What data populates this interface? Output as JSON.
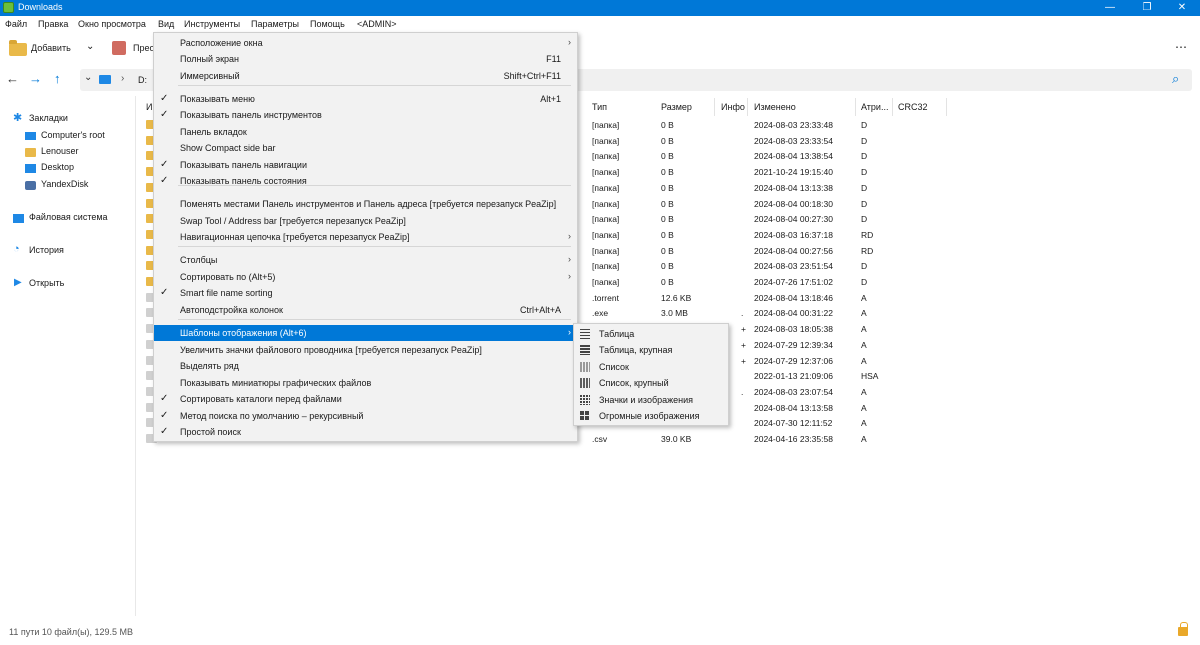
{
  "window": {
    "title": "Downloads",
    "min": "—",
    "max": "❐",
    "close": "✕"
  },
  "menubar": [
    "Файл",
    "Правка",
    "Окно просмотра",
    "Вид",
    "Инструменты",
    "Параметры",
    "Помощь",
    "<ADMIN>"
  ],
  "toolbar": {
    "add_label": "Добавить",
    "convert_label": "Прео",
    "more": "⋯"
  },
  "address": {
    "path": "D:"
  },
  "sidebar": {
    "bookmarks": "Закладки",
    "items": [
      "Computer's root",
      "Lenouser",
      "Desktop",
      "YandexDisk"
    ],
    "filesystem": "Файловая система",
    "history": "История",
    "open": "Открыть"
  },
  "columns": {
    "name": "И",
    "type": "Тип",
    "size": "Размер",
    "info": "Инфо",
    "modified": "Изменено",
    "attr": "Атри...",
    "crc": "CRC32"
  },
  "rows": [
    {
      "type": "[папка]",
      "size": "0 B",
      "info": "",
      "modified": "2024-08-03 23:33:48",
      "attr": "D"
    },
    {
      "type": "[папка]",
      "size": "0 B",
      "info": "",
      "modified": "2024-08-03 23:33:54",
      "attr": "D"
    },
    {
      "type": "[папка]",
      "size": "0 B",
      "info": "",
      "modified": "2024-08-04 13:38:54",
      "attr": "D"
    },
    {
      "type": "[папка]",
      "size": "0 B",
      "info": "",
      "modified": "2021-10-24 19:15:40",
      "attr": "D"
    },
    {
      "type": "[папка]",
      "size": "0 B",
      "info": "",
      "modified": "2024-08-04 13:13:38",
      "attr": "D"
    },
    {
      "type": "[папка]",
      "size": "0 B",
      "info": "",
      "modified": "2024-08-04 00:18:30",
      "attr": "D"
    },
    {
      "type": "[папка]",
      "size": "0 B",
      "info": "",
      "modified": "2024-08-04 00:27:30",
      "attr": "D"
    },
    {
      "type": "[папка]",
      "size": "0 B",
      "info": "",
      "modified": "2024-08-03 16:37:18",
      "attr": "RD"
    },
    {
      "type": "[папка]",
      "size": "0 B",
      "info": "",
      "modified": "2024-08-04 00:27:56",
      "attr": "RD"
    },
    {
      "type": "[папка]",
      "size": "0 B",
      "info": "",
      "modified": "2024-08-03 23:51:54",
      "attr": "D"
    },
    {
      "type": "[папка]",
      "size": "0 B",
      "info": "",
      "modified": "2024-07-26 17:51:02",
      "attr": "D"
    },
    {
      "type": ".torrent",
      "size": "12.6 KB",
      "info": "",
      "modified": "2024-08-04 13:18:46",
      "attr": "A"
    },
    {
      "type": ".exe",
      "size": "3.0 MB",
      "info": ".",
      "modified": "2024-08-04 00:31:22",
      "attr": "A"
    },
    {
      "type": "",
      "size": "",
      "info": "+",
      "modified": "2024-08-03 18:05:38",
      "attr": "A"
    },
    {
      "type": "",
      "size": "",
      "info": "+",
      "modified": "2024-07-29 12:39:34",
      "attr": "A"
    },
    {
      "type": "",
      "size": "",
      "info": "+",
      "modified": "2024-07-29 12:37:06",
      "attr": "A"
    },
    {
      "type": "",
      "size": "",
      "info": "",
      "modified": "2022-01-13 21:09:06",
      "attr": "HSA"
    },
    {
      "type": "",
      "size": "",
      "info": ".",
      "modified": "2024-08-03 23:07:54",
      "attr": "A"
    },
    {
      "type": "",
      "size": "",
      "info": "",
      "modified": "2024-08-04 13:13:58",
      "attr": "A"
    },
    {
      "type": "",
      "size": "",
      "info": "",
      "modified": "2024-07-30 12:11:52",
      "attr": "A"
    },
    {
      "type": ".csv",
      "size": "39.0 KB",
      "info": "",
      "modified": "2024-04-16 23:35:58",
      "attr": "A"
    }
  ],
  "status": {
    "text": "11 пути 10 файл(ы), 129.5 MB"
  },
  "view_menu": {
    "items": [
      {
        "label": "Расположение окна",
        "check": "",
        "shortcut": "",
        "arrow": "›"
      },
      {
        "label": "Полный экран",
        "check": "",
        "shortcut": "F11",
        "arrow": ""
      },
      {
        "label": "Иммерсивный",
        "check": "",
        "shortcut": "Shift+Ctrl+F11",
        "arrow": ""
      },
      {
        "label": "Показывать меню",
        "check": "✓",
        "shortcut": "Alt+1",
        "arrow": ""
      },
      {
        "label": "Показывать панель инструментов",
        "check": "✓",
        "shortcut": "",
        "arrow": ""
      },
      {
        "label": "Панель вкладок",
        "check": "",
        "shortcut": "",
        "arrow": ""
      },
      {
        "label": "Show Compact side bar",
        "check": "",
        "shortcut": "",
        "arrow": ""
      },
      {
        "label": "Показывать панель навигации",
        "check": "✓",
        "shortcut": "",
        "arrow": ""
      },
      {
        "label": "Показывать панель состояния",
        "check": "✓",
        "shortcut": "",
        "arrow": ""
      },
      {
        "label": "Поменять местами Панель инструментов и Панель адреса [требуется перезапуск PeaZip]",
        "check": "",
        "shortcut": "",
        "arrow": ""
      },
      {
        "label": "Swap Tool / Address bar [требуется перезапуск PeaZip]",
        "check": "",
        "shortcut": "",
        "arrow": ""
      },
      {
        "label": "Навигационная цепочка [требуется перезапуск PeaZip]",
        "check": "",
        "shortcut": "",
        "arrow": "›"
      },
      {
        "label": "Столбцы",
        "check": "",
        "shortcut": "",
        "arrow": "›"
      },
      {
        "label": "Сортировать по (Alt+5)",
        "check": "",
        "shortcut": "",
        "arrow": "›"
      },
      {
        "label": "Smart file name sorting",
        "check": "✓",
        "shortcut": "",
        "arrow": ""
      },
      {
        "label": "Автоподстройка колонок",
        "check": "",
        "shortcut": "Ctrl+Alt+A",
        "arrow": ""
      },
      {
        "label": "Шаблоны отображения (Alt+6)",
        "check": "",
        "shortcut": "",
        "arrow": "›"
      },
      {
        "label": "Увеличить значки файлового проводника [требуется перезапуск PeaZip]",
        "check": "",
        "shortcut": "",
        "arrow": ""
      },
      {
        "label": "Выделять ряд",
        "check": "",
        "shortcut": "",
        "arrow": ""
      },
      {
        "label": "Показывать миниатюры графических файлов",
        "check": "",
        "shortcut": "",
        "arrow": ""
      },
      {
        "label": "Сортировать каталоги перед файлами",
        "check": "✓",
        "shortcut": "",
        "arrow": ""
      },
      {
        "label": "Метод поиска по умолчанию – рекурсивный",
        "check": "✓",
        "shortcut": "",
        "arrow": ""
      },
      {
        "label": "Простой поиск",
        "check": "✓",
        "shortcut": "",
        "arrow": ""
      }
    ]
  },
  "layout_submenu": {
    "items": [
      {
        "label": "Таблица",
        "icon": "table-icon"
      },
      {
        "label": "Таблица, крупная",
        "icon": "table-large-icon"
      },
      {
        "label": "Список",
        "icon": "list-icon"
      },
      {
        "label": "Список, крупный",
        "icon": "list-large-icon"
      },
      {
        "label": "Значки и изображения",
        "icon": "icons-icon"
      },
      {
        "label": "Огромные изображения",
        "icon": "huge-icons-icon"
      }
    ]
  },
  "colors": {
    "accent": "#0078d7",
    "folder": "#e9b949",
    "menu_bg": "#f2f2f2"
  }
}
